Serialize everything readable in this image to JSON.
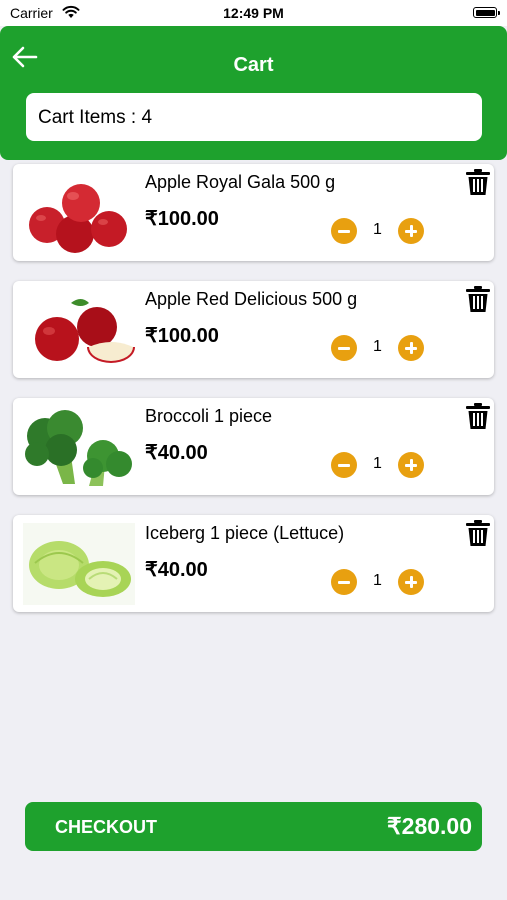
{
  "status_bar": {
    "carrier": "Carrier",
    "time": "12:49 PM"
  },
  "header": {
    "title": "Cart",
    "cart_items_text": "Cart Items : 4"
  },
  "icons": {
    "back": "arrow-left-icon",
    "delete": "trash-icon",
    "decrease": "minus-circle-icon",
    "increase": "plus-circle-icon"
  },
  "colors": {
    "brand_green": "#1ea12d",
    "qty_button": "#e8a010",
    "background": "#efeff4"
  },
  "cart": {
    "items": [
      {
        "name": "Apple Royal Gala 500 g",
        "price": "₹100.00",
        "quantity": "1"
      },
      {
        "name": "Apple Red Delicious 500 g",
        "price": "₹100.00",
        "quantity": "1"
      },
      {
        "name": "Broccoli 1 piece",
        "price": "₹40.00",
        "quantity": "1"
      },
      {
        "name": "Iceberg 1 piece (Lettuce)",
        "price": "₹40.00",
        "quantity": "1"
      }
    ]
  },
  "checkout": {
    "label": "CHECKOUT",
    "total": "₹280.00"
  }
}
